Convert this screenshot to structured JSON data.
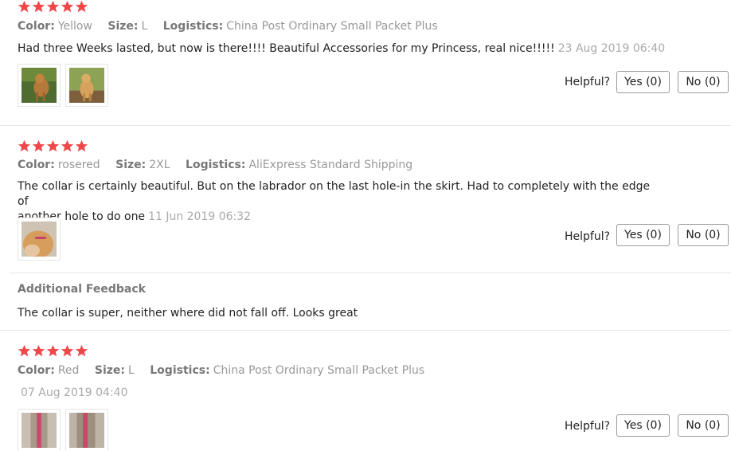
{
  "colors": {
    "star": "#f0474a",
    "divider": "#e8e8e8",
    "label": "#777777",
    "value": "#999999"
  },
  "reviews": [
    {
      "rating": 5,
      "color_label": "Color:",
      "color": "Yellow",
      "size_label": "Size:",
      "size": "L",
      "logistics_label": "Logistics:",
      "logistics": "China Post Ordinary Small Packet Plus",
      "text": "Had three Weeks lasted, but now is there!!!! Beautiful Accessories for my Princess, real nice!!!!!",
      "date": "23 Aug 2019 06:40",
      "helpful_label": "Helpful?",
      "yes_label": "Yes (0)",
      "no_label": "No (0)",
      "images": [
        "dog-photo",
        "dog-photo"
      ]
    },
    {
      "rating": 5,
      "color_label": "Color:",
      "color": "rosered",
      "size_label": "Size:",
      "size": "2XL",
      "logistics_label": "Logistics:",
      "logistics": "AliExpress Standard Shipping",
      "text_line1": "The collar is certainly beautiful. But on the labrador on the last hole-in the skirt. Had to completely with the edge of",
      "text_line2": "another hole to do one",
      "date": "11 Jun 2019 06:32",
      "helpful_label": "Helpful?",
      "yes_label": "Yes (0)",
      "no_label": "No (0)",
      "images": [
        "dog-photo"
      ],
      "additional_feedback_title": "Additional Feedback",
      "additional_feedback": "The collar is super, neither where did not fall off. Looks great"
    },
    {
      "rating": 5,
      "color_label": "Color:",
      "color": "Red",
      "size_label": "Size:",
      "size": "L",
      "logistics_label": "Logistics:",
      "logistics": "China Post Ordinary Small Packet Plus",
      "date": "07 Aug 2019 04:40",
      "helpful_label": "Helpful?",
      "yes_label": "Yes (0)",
      "no_label": "No (0)",
      "images": [
        "collar-photo",
        "collar-photo"
      ]
    }
  ]
}
